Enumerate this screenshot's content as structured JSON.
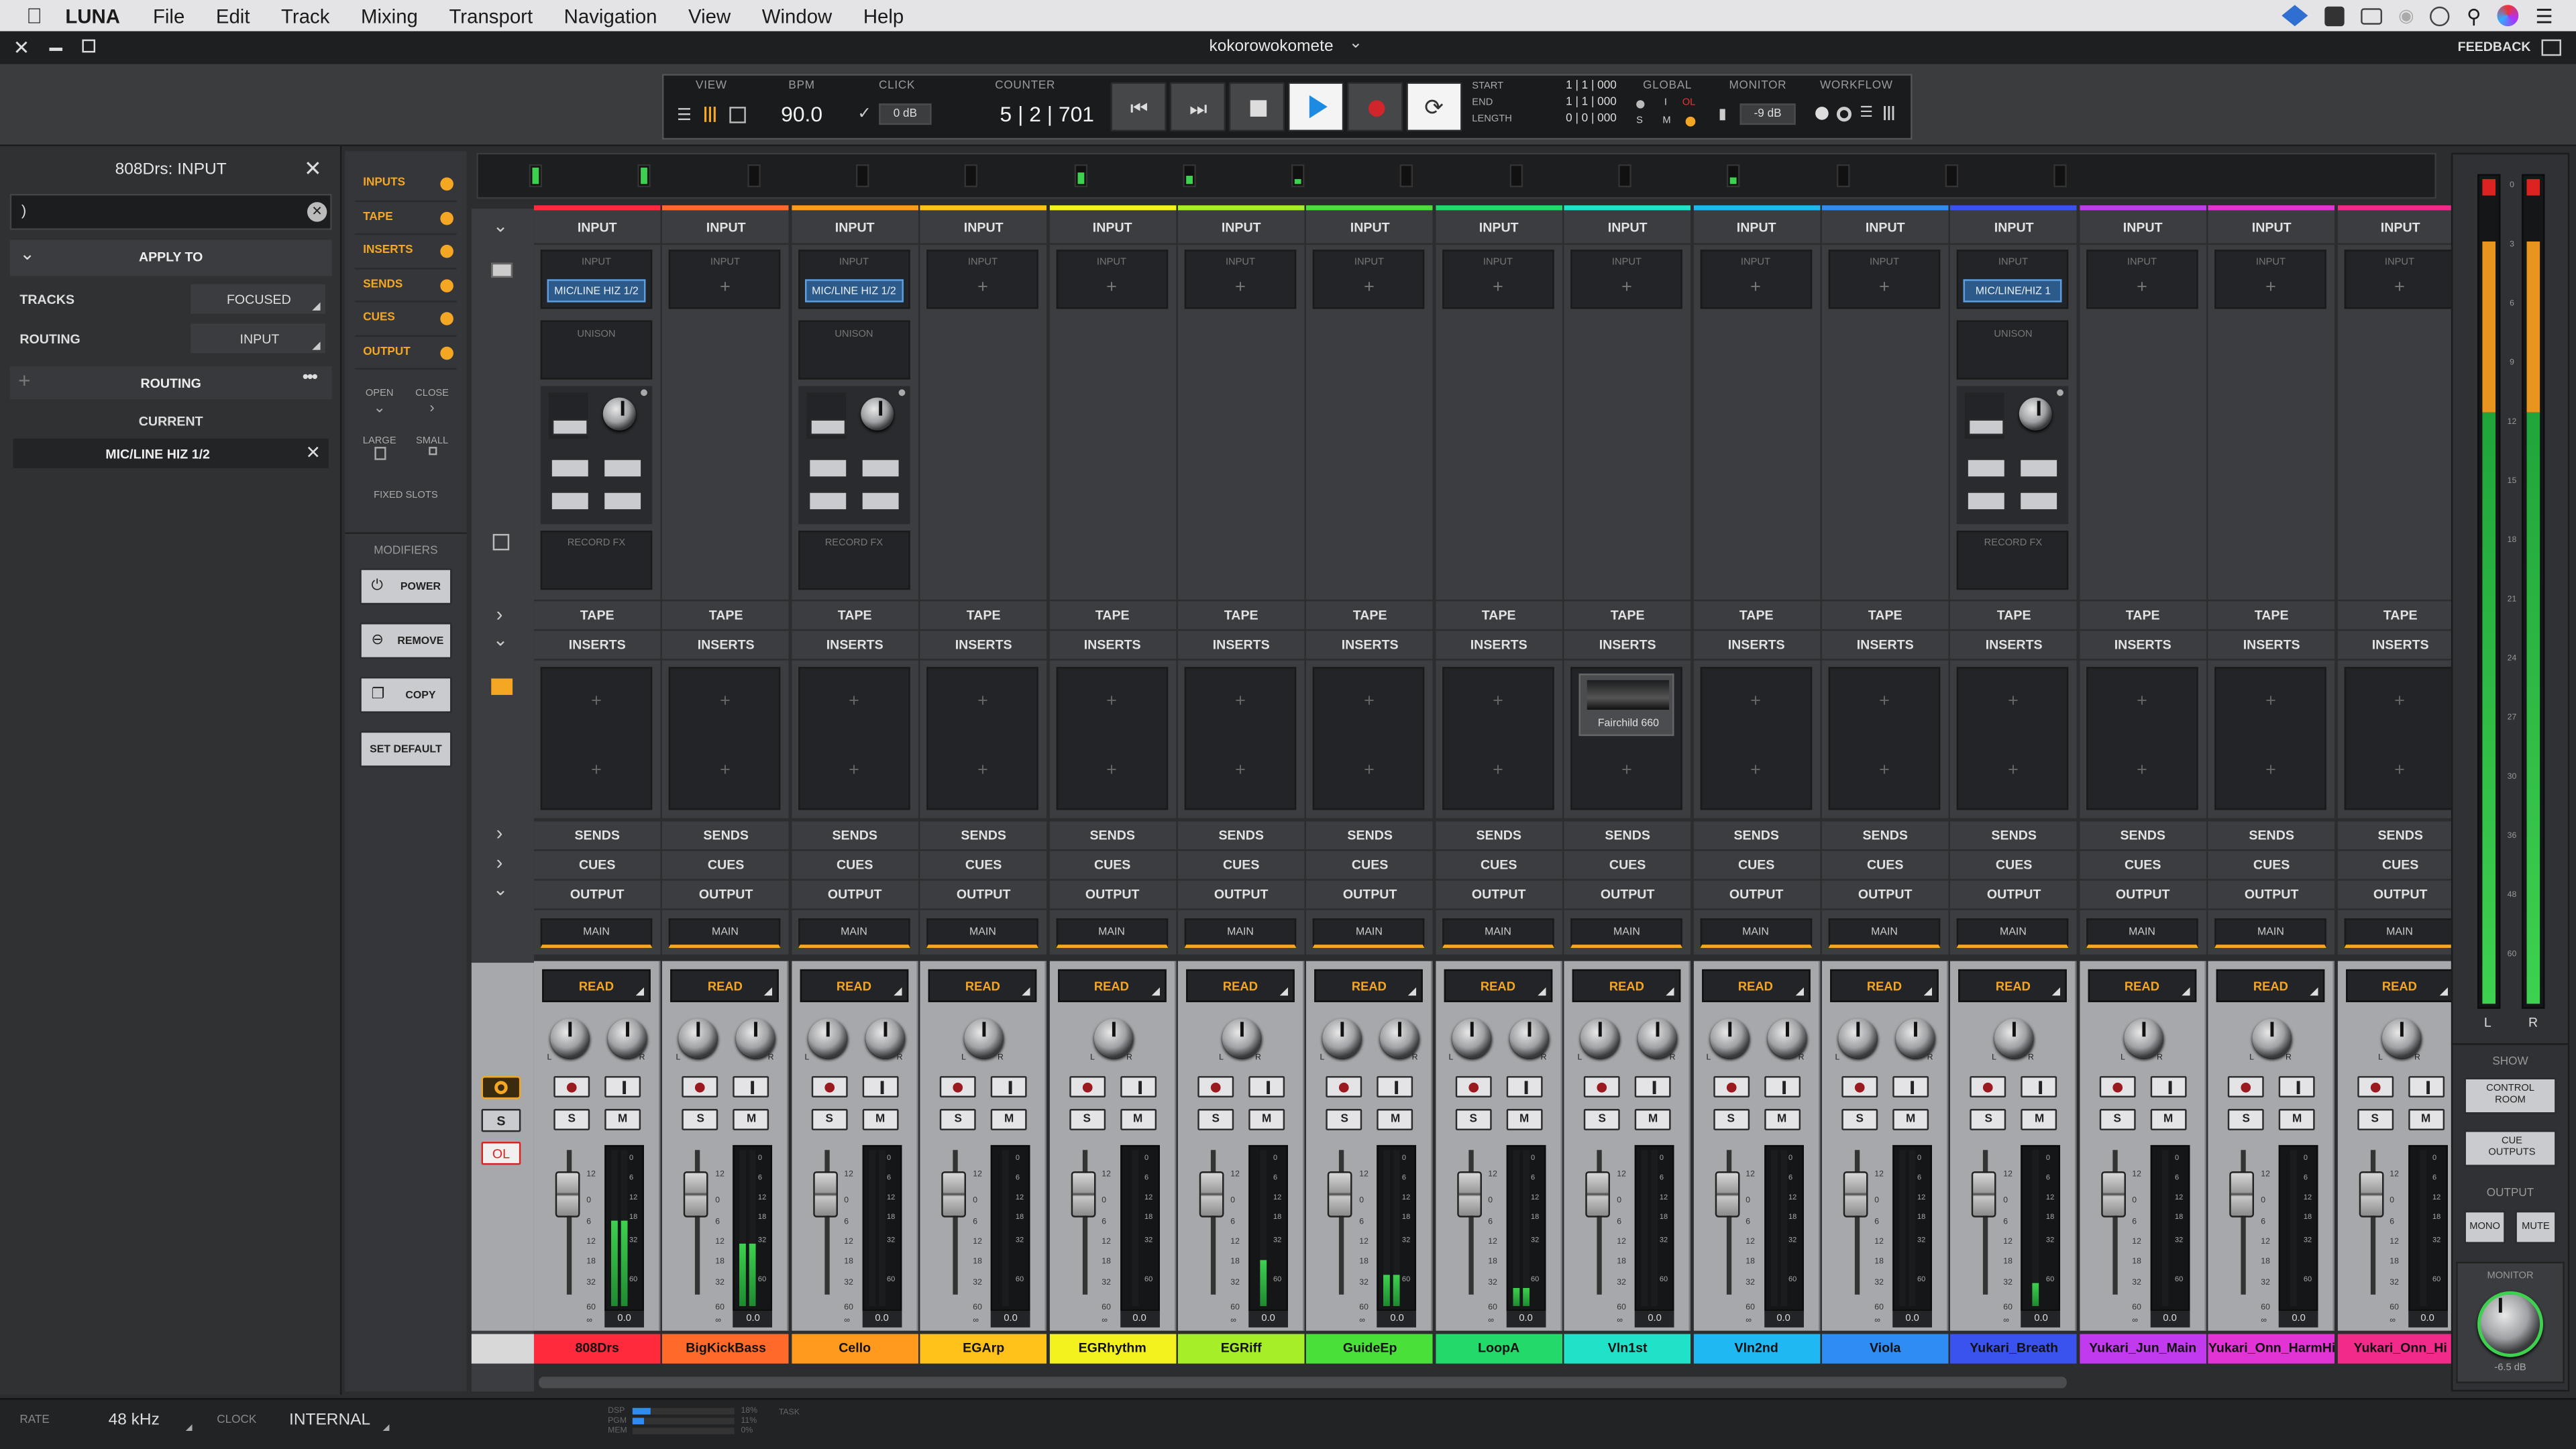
{
  "menu": {
    "app": "LUNA",
    "items": [
      "File",
      "Edit",
      "Track",
      "Mixing",
      "Transport",
      "Navigation",
      "View",
      "Window",
      "Help"
    ]
  },
  "window": {
    "title": "kokorowokomete",
    "feedback": "FEEDBACK"
  },
  "transport": {
    "view_label": "VIEW",
    "bpm_label": "BPM",
    "bpm": "90.0",
    "click_label": "CLICK",
    "click_level": "0 dB",
    "counter_label": "COUNTER",
    "counter": "5 | 2 | 701",
    "start_label": "START",
    "end_label": "END",
    "length_label": "LENGTH",
    "start": "1 | 1 | 000",
    "end": "1 | 1 | 000",
    "length": "0 | 0 | 000",
    "global_label": "GLOBAL",
    "global_s": "S",
    "global_m": "M",
    "global_i": "I",
    "global_ol": "OL",
    "monitor_label": "MONITOR",
    "monitor_level": "-9 dB",
    "workflow_label": "WORKFLOW"
  },
  "input_panel": {
    "title": "808Drs: INPUT",
    "search_value": ")",
    "apply_to": "APPLY TO",
    "tracks_label": "TRACKS",
    "tracks_value": "FOCUSED",
    "routing_label": "ROUTING",
    "routing_value": "INPUT",
    "routing_section": "ROUTING",
    "current_label": "CURRENT",
    "current_value": "MIC/LINE HIZ 1/2"
  },
  "sections": {
    "items": [
      "INPUTS",
      "TAPE",
      "INSERTS",
      "SENDS",
      "CUES",
      "OUTPUT"
    ],
    "open": "OPEN",
    "close": "CLOSE",
    "large": "LARGE",
    "small": "SMALL",
    "fixed_slots": "FIXED SLOTS",
    "modifiers": "MODIFIERS",
    "power": "POWER",
    "remove": "REMOVE",
    "copy": "COPY",
    "set_default": "SET DEFAULT"
  },
  "strip_labels": {
    "input": "INPUT",
    "slot_input": "INPUT",
    "unison": "UNISON",
    "record_fx": "RECORD FX",
    "tape": "TAPE",
    "inserts": "INSERTS",
    "sends": "SENDS",
    "cues": "CUES",
    "output": "OUTPUT",
    "main": "MAIN",
    "read": "READ",
    "s": "S",
    "m": "M",
    "l": "L",
    "r": "R",
    "level": "0.0",
    "scale": [
      "12",
      "0",
      "6",
      "12",
      "18",
      "32",
      "60",
      "∞"
    ]
  },
  "channels": [
    {
      "name": "808Drs",
      "color": "#ff2a3c",
      "input": "MIC/LINE HIZ 1/2",
      "unison": true,
      "stereo": true,
      "level_pct": 55
    },
    {
      "name": "BigKickBass",
      "color": "#ff6a2a",
      "input": "",
      "unison": false,
      "stereo": true,
      "level_pct": 40
    },
    {
      "name": "Cello",
      "color": "#ff9a1e",
      "input": "MIC/LINE HIZ 1/2",
      "unison": true,
      "stereo": true,
      "level_pct": 0
    },
    {
      "name": "EGArp",
      "color": "#ffc21a",
      "input": "",
      "unison": false,
      "stereo": false,
      "level_pct": 0
    },
    {
      "name": "EGRhythm",
      "color": "#f4f21e",
      "input": "",
      "unison": false,
      "stereo": false,
      "level_pct": 0
    },
    {
      "name": "EGRiff",
      "color": "#a6ee28",
      "input": "",
      "unison": false,
      "stereo": false,
      "level_pct": 30
    },
    {
      "name": "GuideEp",
      "color": "#4ae03a",
      "input": "",
      "unison": false,
      "stereo": true,
      "level_pct": 20
    },
    {
      "name": "LoopA",
      "color": "#22d96a",
      "input": "",
      "unison": false,
      "stereo": true,
      "level_pct": 12
    },
    {
      "name": "Vln1st",
      "color": "#1fe2c8",
      "input": "",
      "unison": false,
      "stereo": true,
      "level_pct": 0,
      "insert": "Fairchild 660"
    },
    {
      "name": "Vln2nd",
      "color": "#1fb8f2",
      "input": "",
      "unison": false,
      "stereo": true,
      "level_pct": 0
    },
    {
      "name": "Viola",
      "color": "#2e8cf2",
      "input": "",
      "unison": false,
      "stereo": true,
      "level_pct": 0
    },
    {
      "name": "Yukari_Breath",
      "color": "#3a52ee",
      "input": "MIC/LINE/HIZ 1",
      "unison": true,
      "stereo": false,
      "level_pct": 15
    },
    {
      "name": "Yukari_Jun_Main",
      "color": "#c23aee",
      "input": "",
      "unison": false,
      "stereo": false,
      "level_pct": 0
    },
    {
      "name": "Yukari_Onn_HarmHi",
      "color": "#e234d4",
      "input": "",
      "unison": false,
      "stereo": false,
      "level_pct": 0
    },
    {
      "name": "Yukari_Onn_Hi",
      "color": "#f22a8a",
      "input": "",
      "unison": false,
      "stereo": false,
      "level_pct": 0
    }
  ],
  "meter": {
    "l": "L",
    "r": "R",
    "scale": [
      "0",
      "3",
      "6",
      "9",
      "12",
      "15",
      "18",
      "21",
      "24",
      "27",
      "30",
      "36",
      "48",
      "60"
    ]
  },
  "right_panel": {
    "show": "SHOW",
    "control_room": "CONTROL ROOM",
    "cue_outputs": "CUE OUTPUTS",
    "output": "OUTPUT",
    "mono": "MONO",
    "mute": "MUTE",
    "monitor": "MONITOR",
    "monitor_level": "-6.5 dB"
  },
  "status": {
    "rate_label": "RATE",
    "rate": "48 kHz",
    "clock_label": "CLOCK",
    "clock": "INTERNAL",
    "dsp": "DSP",
    "pgm": "PGM",
    "mem": "MEM",
    "dsp_pct": "18%",
    "pgm_pct": "11%",
    "mem_pct": "0%",
    "task": "TASK"
  },
  "colors": {
    "accent": "#f5a623",
    "play": "#1e8be3",
    "record": "#d0262b"
  }
}
